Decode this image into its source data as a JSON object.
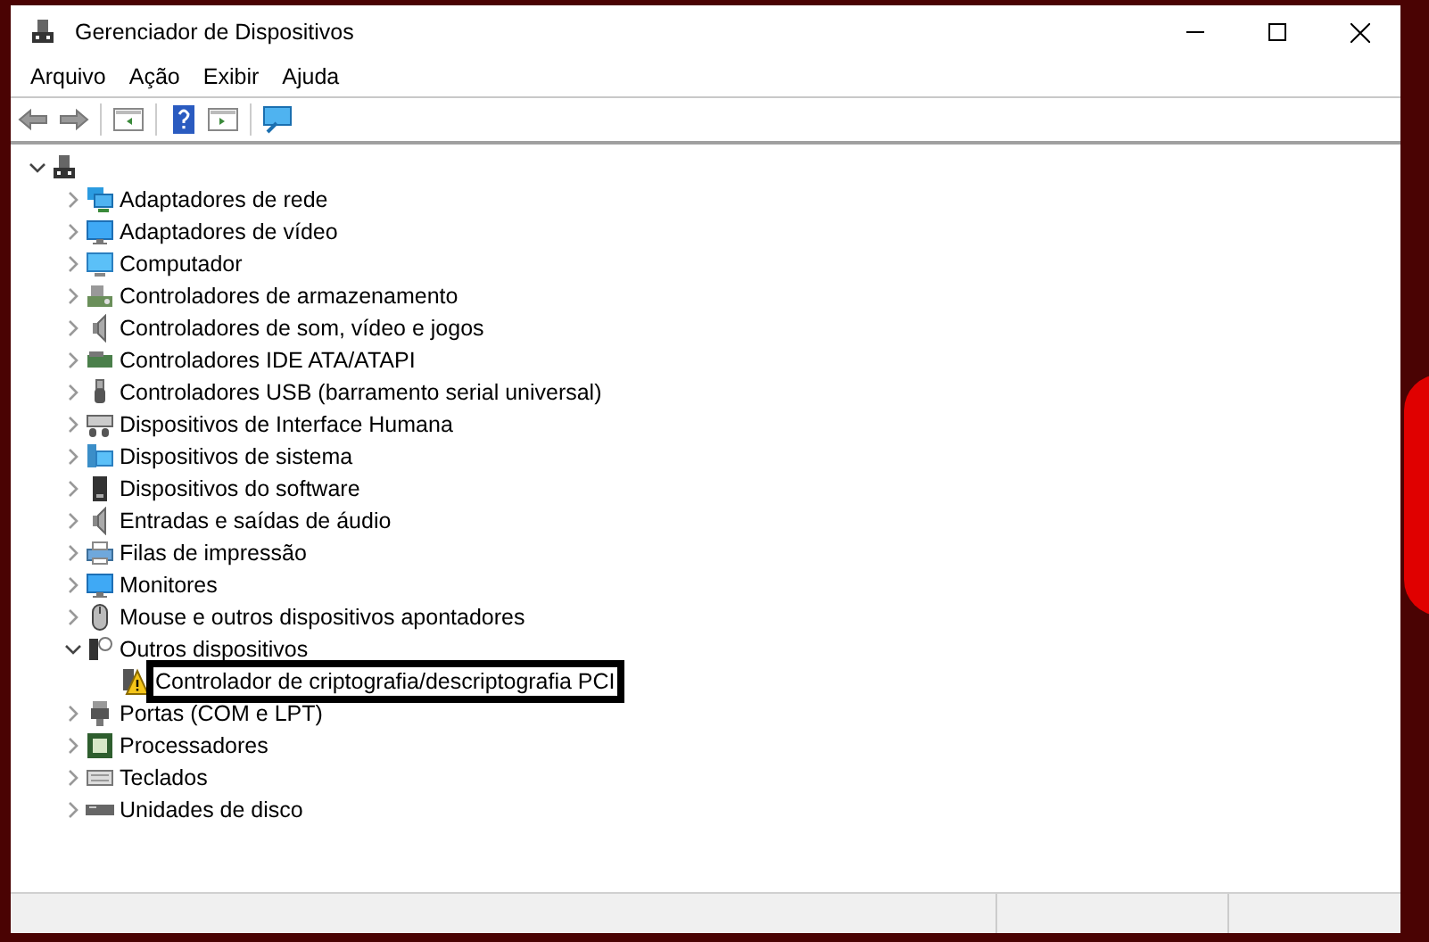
{
  "window": {
    "title": "Gerenciador de Dispositivos"
  },
  "menu": [
    "Arquivo",
    "Ação",
    "Exibir",
    "Ajuda"
  ],
  "tree": {
    "expanded": true,
    "children": [
      {
        "label": "Adaptadores de rede",
        "kind": "network",
        "expanded": false,
        "selected": false
      },
      {
        "label": "Adaptadores de vídeo",
        "kind": "display",
        "expanded": false,
        "selected": false
      },
      {
        "label": "Computador",
        "kind": "computer",
        "expanded": false,
        "selected": false
      },
      {
        "label": "Controladores de armazenamento",
        "kind": "storage",
        "expanded": false,
        "selected": false
      },
      {
        "label": "Controladores de som, vídeo e jogos",
        "kind": "sound",
        "expanded": false,
        "selected": false
      },
      {
        "label": "Controladores IDE ATA/ATAPI",
        "kind": "ide",
        "expanded": false,
        "selected": false
      },
      {
        "label": "Controladores USB (barramento serial universal)",
        "kind": "usb",
        "expanded": false,
        "selected": false
      },
      {
        "label": "Dispositivos de Interface Humana",
        "kind": "hid",
        "expanded": false,
        "selected": false
      },
      {
        "label": "Dispositivos de sistema",
        "kind": "system",
        "expanded": false,
        "selected": false
      },
      {
        "label": "Dispositivos do software",
        "kind": "software",
        "expanded": false,
        "selected": false
      },
      {
        "label": "Entradas e saídas de áudio",
        "kind": "sound",
        "expanded": false,
        "selected": false
      },
      {
        "label": "Filas de impressão",
        "kind": "printer",
        "expanded": false,
        "selected": false
      },
      {
        "label": "Monitores",
        "kind": "display",
        "expanded": false,
        "selected": false
      },
      {
        "label": "Mouse e outros dispositivos apontadores",
        "kind": "mouse",
        "expanded": false,
        "selected": false
      },
      {
        "label": "Outros dispositivos",
        "kind": "other",
        "expanded": true,
        "selected": false,
        "children": [
          {
            "label": "Controlador de criptografia/descriptografia PCI",
            "kind": "unknown",
            "warning": true,
            "selected": true
          }
        ]
      },
      {
        "label": "Portas (COM e LPT)",
        "kind": "ports",
        "expanded": false,
        "selected": false
      },
      {
        "label": "Processadores",
        "kind": "processor",
        "expanded": false,
        "selected": false
      },
      {
        "label": "Teclados",
        "kind": "keyboard",
        "expanded": false,
        "selected": false
      },
      {
        "label": "Unidades de disco",
        "kind": "disk",
        "expanded": false,
        "selected": false
      }
    ]
  }
}
